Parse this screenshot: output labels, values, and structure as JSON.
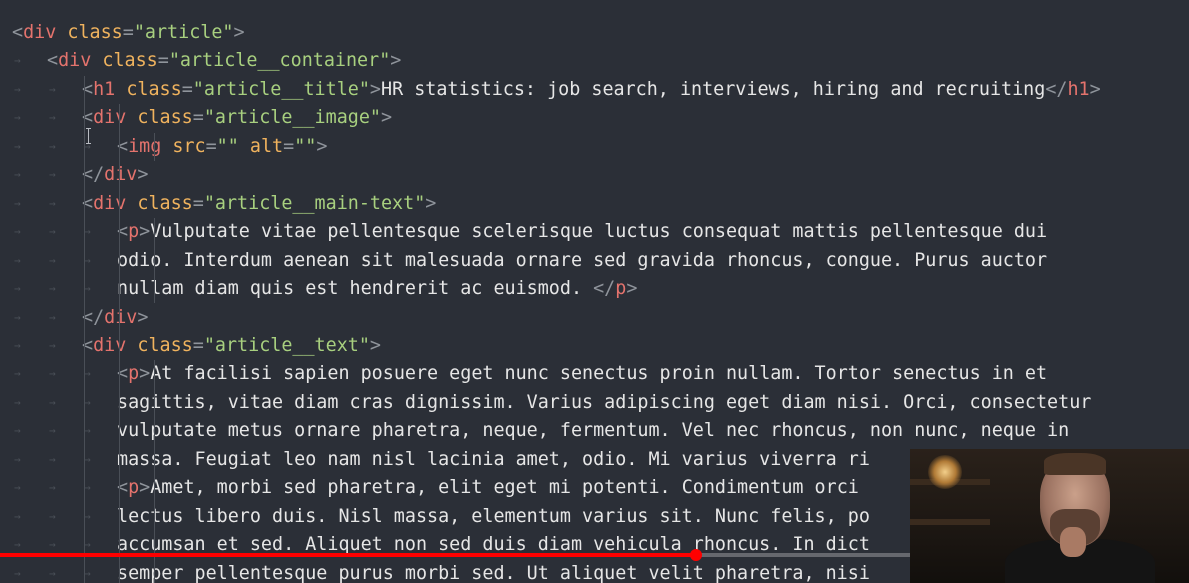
{
  "editor": {
    "lines": [
      {
        "tokens": [
          [
            "punct",
            "<"
          ],
          [
            "tag",
            "div"
          ],
          [
            "text",
            " "
          ],
          [
            "attr",
            "class"
          ],
          [
            "punct",
            "="
          ],
          [
            "str",
            "\"article\""
          ],
          [
            "punct",
            ">"
          ]
        ]
      },
      {
        "tokens": [
          [
            "punct",
            "<"
          ],
          [
            "tag",
            "div"
          ],
          [
            "text",
            " "
          ],
          [
            "attr",
            "class"
          ],
          [
            "punct",
            "="
          ],
          [
            "str",
            "\"article__container\""
          ],
          [
            "punct",
            ">"
          ]
        ]
      },
      {
        "tokens": [
          [
            "punct",
            "<"
          ],
          [
            "tag",
            "h1"
          ],
          [
            "text",
            " "
          ],
          [
            "attr",
            "class"
          ],
          [
            "punct",
            "="
          ],
          [
            "str",
            "\"article__title\""
          ],
          [
            "punct",
            ">"
          ],
          [
            "text",
            "HR statistics: job search, interviews, hiring and recruiting"
          ],
          [
            "punct",
            "</"
          ],
          [
            "tag",
            "h1"
          ],
          [
            "punct",
            ">"
          ]
        ]
      },
      {
        "tokens": [
          [
            "punct",
            "<"
          ],
          [
            "tag",
            "div"
          ],
          [
            "text",
            " "
          ],
          [
            "attr",
            "class"
          ],
          [
            "punct",
            "="
          ],
          [
            "str",
            "\"article__image\""
          ],
          [
            "punct",
            ">"
          ]
        ]
      },
      {
        "tokens": [
          [
            "punct",
            "<"
          ],
          [
            "tag",
            "img"
          ],
          [
            "text",
            " "
          ],
          [
            "attr",
            "src"
          ],
          [
            "punct",
            "="
          ],
          [
            "str",
            "\"\""
          ],
          [
            "text",
            " "
          ],
          [
            "attr",
            "alt"
          ],
          [
            "punct",
            "="
          ],
          [
            "str",
            "\"\""
          ],
          [
            "punct",
            ">"
          ]
        ]
      },
      {
        "tokens": [
          [
            "punct",
            "</"
          ],
          [
            "tag",
            "div"
          ],
          [
            "punct",
            ">"
          ]
        ]
      },
      {
        "tokens": [
          [
            "punct",
            "<"
          ],
          [
            "tag",
            "div"
          ],
          [
            "text",
            " "
          ],
          [
            "attr",
            "class"
          ],
          [
            "punct",
            "="
          ],
          [
            "str",
            "\"article__main-text\""
          ],
          [
            "punct",
            ">"
          ]
        ]
      },
      {
        "tokens": [
          [
            "punct",
            "<"
          ],
          [
            "tag",
            "p"
          ],
          [
            "punct",
            ">"
          ],
          [
            "text",
            "Vulputate vitae pellentesque scelerisque luctus consequat mattis pellentesque dui"
          ]
        ]
      },
      {
        "tokens": [
          [
            "text",
            "odio. Interdum aenean sit malesuada ornare sed gravida rhoncus, congue. Purus auctor"
          ]
        ]
      },
      {
        "tokens": [
          [
            "text",
            "nullam diam quis est hendrerit ac euismod. "
          ],
          [
            "punct",
            "</"
          ],
          [
            "tag",
            "p"
          ],
          [
            "punct",
            ">"
          ]
        ]
      },
      {
        "tokens": [
          [
            "punct",
            "</"
          ],
          [
            "tag",
            "div"
          ],
          [
            "punct",
            ">"
          ]
        ]
      },
      {
        "tokens": [
          [
            "punct",
            "<"
          ],
          [
            "tag",
            "div"
          ],
          [
            "text",
            " "
          ],
          [
            "attr",
            "class"
          ],
          [
            "punct",
            "="
          ],
          [
            "str",
            "\"article__text\""
          ],
          [
            "punct",
            ">"
          ]
        ]
      },
      {
        "tokens": [
          [
            "punct",
            "<"
          ],
          [
            "tag",
            "p"
          ],
          [
            "punct",
            ">"
          ],
          [
            "text",
            "At facilisi sapien posuere eget nunc senectus proin nullam. Tortor senectus in et"
          ]
        ]
      },
      {
        "tokens": [
          [
            "text",
            "sagittis, vitae diam cras dignissim. Varius adipiscing eget diam nisi. Orci, consectetur"
          ]
        ]
      },
      {
        "tokens": [
          [
            "text",
            "vulputate metus ornare pharetra, neque, fermentum. Vel nec rhoncus, non nunc, neque in"
          ]
        ]
      },
      {
        "tokens": [
          [
            "text",
            "massa. Feugiat leo nam nisl lacinia amet, odio. Mi varius viverra ri"
          ]
        ]
      },
      {
        "tokens": [
          [
            "punct",
            "<"
          ],
          [
            "tag",
            "p"
          ],
          [
            "punct",
            ">"
          ],
          [
            "text",
            "Amet, morbi sed pharetra, elit eget mi potenti. Condimentum orci"
          ]
        ]
      },
      {
        "tokens": [
          [
            "text",
            "lectus libero duis. Nisl massa, elementum varius sit. Nunc felis, po"
          ]
        ]
      },
      {
        "tokens": [
          [
            "text",
            "accumsan et sed. Aliquet non sed duis diam vehicula rhoncus. In dict"
          ]
        ]
      },
      {
        "tokens": [
          [
            "text",
            "semper pellentesque purus morbi sed. Ut aliquet velit pharetra, nisi"
          ]
        ]
      }
    ]
  },
  "video": {
    "progress_fraction": 0.585,
    "progress_color": "#ff0000"
  },
  "theme": {
    "background": "#2b2f37",
    "tag": "#e4736d",
    "attr": "#f0b35e",
    "string": "#a8d07f",
    "text": "#e6e6e6",
    "punct": "#8f949b"
  }
}
